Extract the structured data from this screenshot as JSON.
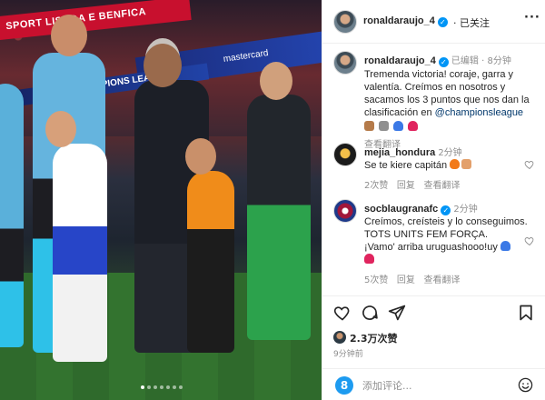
{
  "photo": {
    "banner_left": "SPORT LISBOA E BENFICA",
    "banner_mastercard": "mastercard",
    "banner_league": "PIONS LEAGUE"
  },
  "header": {
    "username": "ronaldaraujo_4",
    "verified_mark": "✓",
    "follow_state": "· 已关注",
    "more_label": "···"
  },
  "caption": {
    "username": "ronaldaraujo_4",
    "edited": "已编辑",
    "time": "8分钟",
    "text": "Tremenda victoria! coraje, garra y valentía. Creímos en nosotros y sacamos los 3 puntos que nos dan la clasificación en",
    "mention": "@championsleague",
    "translate": "查看翻译"
  },
  "comments": [
    {
      "username": "mejia_hondura",
      "time": "2分钟",
      "text": "Se te kiere capitán",
      "likes": "2次赞",
      "reply": "回复",
      "translate": "查看翻译"
    },
    {
      "username": "socblaugranafc",
      "time": "2分钟",
      "text_lines": [
        "Creímos, creísteis y lo conseguimos.",
        "TOTS UNITS FEM FORÇA.",
        "¡Vamo' arriba uruguashooo!uy"
      ],
      "likes": "5次赞",
      "reply": "回复",
      "translate": "查看翻译"
    }
  ],
  "actions": {
    "likes": "2.3万次赞",
    "ago": "9分钟前"
  },
  "composer": {
    "placeholder": "添加评论...",
    "badge": "8"
  },
  "colors": {
    "verified": "#0095f6",
    "link": "#00376b",
    "muted": "#8e8e8e",
    "heart": "#ed4956"
  }
}
